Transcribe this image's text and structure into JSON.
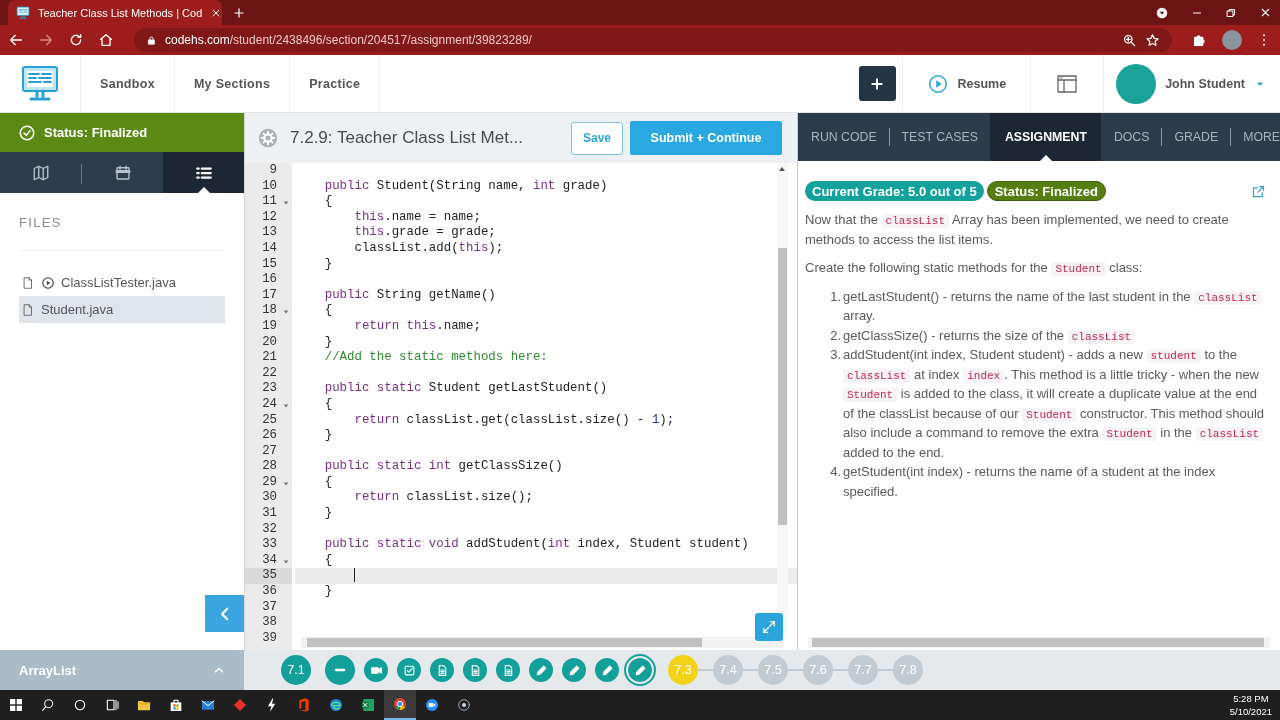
{
  "browser": {
    "tab_title": "Teacher Class List Methods | Cod",
    "url_host": "codehs.com",
    "url_path": "/student/2438496/section/204517/assignment/39823289/"
  },
  "header": {
    "nav": [
      "Sandbox",
      "My Sections",
      "Practice"
    ],
    "resume": "Resume",
    "user": "John Student"
  },
  "sidebar": {
    "status": "Status: Finalized",
    "tabs": [
      {
        "kind": "map",
        "selected": false
      },
      {
        "kind": "calendar",
        "selected": false
      },
      {
        "kind": "files",
        "selected": true
      }
    ],
    "files_heading": "FILES",
    "files": [
      {
        "name": "ClassListTester.java",
        "runnable": true,
        "selected": false
      },
      {
        "name": "Student.java",
        "runnable": false,
        "selected": true
      }
    ],
    "module": "ArrayList"
  },
  "editor": {
    "title": "7.2.9: Teacher Class List Met...",
    "save": "Save",
    "submit": "Submit + Continue",
    "lines": [
      {
        "n": "9",
        "fold": false,
        "current": false
      },
      {
        "n": "10",
        "fold": false,
        "current": false,
        "tokens": [
          {
            "t": "    public",
            "kind": "keyword"
          },
          {
            "t": " Student(String name, ",
            "kind": "plain"
          },
          {
            "t": "int",
            "kind": "keyword"
          },
          {
            "t": " grade)",
            "kind": "plain"
          }
        ]
      },
      {
        "n": "11",
        "fold": true,
        "current": false,
        "tokens": [
          {
            "t": "    {",
            "kind": "plain"
          }
        ]
      },
      {
        "n": "12",
        "fold": false,
        "current": false,
        "tokens": [
          {
            "t": "        this",
            "kind": "keyword"
          },
          {
            "t": ".name = name;",
            "kind": "plain"
          }
        ]
      },
      {
        "n": "13",
        "fold": false,
        "current": false,
        "tokens": [
          {
            "t": "        this",
            "kind": "keyword"
          },
          {
            "t": ".grade = grade;",
            "kind": "plain"
          }
        ]
      },
      {
        "n": "14",
        "fold": false,
        "current": false,
        "tokens": [
          {
            "t": "        classList.add(",
            "kind": "plain"
          },
          {
            "t": "this",
            "kind": "keyword"
          },
          {
            "t": ");",
            "kind": "plain"
          }
        ]
      },
      {
        "n": "15",
        "fold": false,
        "current": false,
        "tokens": [
          {
            "t": "    }",
            "kind": "plain"
          }
        ]
      },
      {
        "n": "16",
        "fold": false,
        "current": false
      },
      {
        "n": "17",
        "fold": false,
        "current": false,
        "tokens": [
          {
            "t": "    public",
            "kind": "keyword"
          },
          {
            "t": " String getName()",
            "kind": "plain"
          }
        ]
      },
      {
        "n": "18",
        "fold": true,
        "current": false,
        "tokens": [
          {
            "t": "    {",
            "kind": "plain"
          }
        ]
      },
      {
        "n": "19",
        "fold": false,
        "current": false,
        "tokens": [
          {
            "t": "        return this",
            "kind": "keyword"
          },
          {
            "t": ".name;",
            "kind": "plain"
          }
        ]
      },
      {
        "n": "20",
        "fold": false,
        "current": false,
        "tokens": [
          {
            "t": "    }",
            "kind": "plain"
          }
        ]
      },
      {
        "n": "21",
        "fold": false,
        "current": false,
        "tokens": [
          {
            "t": "    //Add the static methods here:",
            "kind": "comment"
          }
        ]
      },
      {
        "n": "22",
        "fold": false,
        "current": false
      },
      {
        "n": "23",
        "fold": false,
        "current": false,
        "tokens": [
          {
            "t": "    public static",
            "kind": "keyword"
          },
          {
            "t": " Student getLastStudent()",
            "kind": "plain"
          }
        ]
      },
      {
        "n": "24",
        "fold": true,
        "current": false,
        "tokens": [
          {
            "t": "    {",
            "kind": "plain"
          }
        ]
      },
      {
        "n": "25",
        "fold": false,
        "current": false,
        "tokens": [
          {
            "t": "        return",
            "kind": "keyword"
          },
          {
            "t": " classList.get(classList.size() - ",
            "kind": "plain"
          },
          {
            "t": "1",
            "kind": "number"
          },
          {
            "t": ");",
            "kind": "plain"
          }
        ]
      },
      {
        "n": "26",
        "fold": false,
        "current": false,
        "tokens": [
          {
            "t": "    }",
            "kind": "plain"
          }
        ]
      },
      {
        "n": "27",
        "fold": false,
        "current": false
      },
      {
        "n": "28",
        "fold": false,
        "current": false,
        "tokens": [
          {
            "t": "    public static int",
            "kind": "keyword"
          },
          {
            "t": " getClassSize()",
            "kind": "plain"
          }
        ]
      },
      {
        "n": "29",
        "fold": true,
        "current": false,
        "tokens": [
          {
            "t": "    {",
            "kind": "plain"
          }
        ]
      },
      {
        "n": "30",
        "fold": false,
        "current": false,
        "tokens": [
          {
            "t": "        return",
            "kind": "keyword"
          },
          {
            "t": " classList.size();",
            "kind": "plain"
          }
        ]
      },
      {
        "n": "31",
        "fold": false,
        "current": false,
        "tokens": [
          {
            "t": "    }",
            "kind": "plain"
          }
        ]
      },
      {
        "n": "32",
        "fold": false,
        "current": false
      },
      {
        "n": "33",
        "fold": false,
        "current": false,
        "tokens": [
          {
            "t": "    public static void",
            "kind": "keyword"
          },
          {
            "t": " addStudent(",
            "kind": "plain"
          },
          {
            "t": "int",
            "kind": "keyword"
          },
          {
            "t": " index, Student student)",
            "kind": "plain"
          }
        ]
      },
      {
        "n": "34",
        "fold": true,
        "current": false,
        "tokens": [
          {
            "t": "    {",
            "kind": "plain"
          }
        ]
      },
      {
        "n": "35",
        "fold": false,
        "current": true
      },
      {
        "n": "36",
        "fold": false,
        "current": false,
        "tokens": [
          {
            "t": "    }",
            "kind": "plain"
          }
        ]
      },
      {
        "n": "37",
        "fold": false,
        "current": false
      },
      {
        "n": "38",
        "fold": false,
        "current": false
      },
      {
        "n": "39",
        "fold": false,
        "current": false
      }
    ]
  },
  "assignment": {
    "tabs": [
      {
        "label": "RUN CODE",
        "selected": false
      },
      {
        "label": "TEST CASES",
        "selected": false
      },
      {
        "label": "ASSIGNMENT",
        "selected": true
      },
      {
        "label": "DOCS",
        "selected": false
      },
      {
        "label": "GRADE",
        "selected": false
      },
      {
        "label": "MORE",
        "selected": false
      }
    ],
    "grade": "Current Grade: 5.0 out of 5",
    "status": "Status: Finalized",
    "paragraphs": [
      [
        {
          "t": "Now that the ",
          "kind": "text"
        },
        {
          "t": "classList",
          "kind": "code"
        },
        {
          "t": " Array has been implemented, we need to create methods to access the list items.",
          "kind": "text"
        }
      ],
      [
        {
          "t": "Create the following static methods for the ",
          "kind": "text"
        },
        {
          "t": "Student",
          "kind": "code"
        },
        {
          "t": " class:",
          "kind": "text"
        }
      ]
    ],
    "steps": [
      {
        "marker": "1.",
        "parts": [
          {
            "t": "getLastStudent() - returns the name of the last student in the ",
            "kind": "text"
          },
          {
            "t": "classList",
            "kind": "code"
          },
          {
            "t": " array.",
            "kind": "text"
          }
        ]
      },
      {
        "marker": "2.",
        "parts": [
          {
            "t": "getClassSize() - returns the size of the ",
            "kind": "text"
          },
          {
            "t": "classList",
            "kind": "code"
          }
        ]
      },
      {
        "marker": "3.",
        "parts": [
          {
            "t": "addStudent(int index, Student student) - adds a new ",
            "kind": "text"
          },
          {
            "t": "student",
            "kind": "code"
          },
          {
            "t": " to the ",
            "kind": "text"
          },
          {
            "t": "classList",
            "kind": "code"
          },
          {
            "t": " at index ",
            "kind": "text"
          },
          {
            "t": "index",
            "kind": "code"
          },
          {
            "t": ". This method is a little tricky - when the new ",
            "kind": "text"
          },
          {
            "t": "Student",
            "kind": "code"
          },
          {
            "t": " is added to the class, it will create a duplicate value at the end of the classList because of our ",
            "kind": "text"
          },
          {
            "t": "Student",
            "kind": "code"
          },
          {
            "t": " constructor. This method should also include a command to remove the extra ",
            "kind": "text"
          },
          {
            "t": "Student",
            "kind": "code"
          },
          {
            "t": " in the ",
            "kind": "text"
          },
          {
            "t": "classList",
            "kind": "code"
          },
          {
            "t": " added to the end.",
            "kind": "text"
          }
        ]
      },
      {
        "marker": "4.",
        "parts": [
          {
            "t": "getStudent(int index) - returns the name of a student at the index specified.",
            "kind": "text"
          }
        ]
      }
    ]
  },
  "progress": {
    "items": [
      {
        "kind": "lesson",
        "label": "7.1",
        "completed": true,
        "current": false,
        "selected": false
      },
      {
        "kind": "collapse",
        "selected": false
      },
      {
        "kind": "video",
        "selected": false
      },
      {
        "kind": "quiz",
        "selected": false
      },
      {
        "kind": "document",
        "selected": false
      },
      {
        "kind": "document",
        "selected": false
      },
      {
        "kind": "document",
        "selected": false
      },
      {
        "kind": "exercise",
        "selected": false
      },
      {
        "kind": "exercise",
        "selected": false
      },
      {
        "kind": "exercise",
        "selected": false
      },
      {
        "kind": "exercise",
        "selected": true
      },
      {
        "kind": "lesson",
        "label": "7.3",
        "completed": false,
        "current": true,
        "selected": false
      },
      {
        "kind": "lesson",
        "label": "7.4",
        "completed": false,
        "current": false,
        "selected": false
      },
      {
        "kind": "lesson",
        "label": "7.5",
        "completed": false,
        "current": false,
        "selected": false
      },
      {
        "kind": "lesson",
        "label": "7.6",
        "completed": false,
        "current": false,
        "selected": false
      },
      {
        "kind": "lesson",
        "label": "7.7",
        "completed": false,
        "current": false,
        "selected": false
      },
      {
        "kind": "lesson",
        "label": "7.8",
        "completed": false,
        "current": false,
        "selected": false
      }
    ]
  },
  "taskbar": {
    "apps": [
      {
        "kind": "start",
        "active": false
      },
      {
        "kind": "search",
        "active": false
      },
      {
        "kind": "assistant",
        "active": false
      },
      {
        "kind": "taskview",
        "active": false
      },
      {
        "kind": "folder",
        "active": false
      },
      {
        "kind": "store",
        "active": false
      },
      {
        "kind": "mail",
        "active": false
      },
      {
        "kind": "diamond",
        "active": false
      },
      {
        "kind": "bolt",
        "active": false
      },
      {
        "kind": "office",
        "active": false
      },
      {
        "kind": "edge",
        "active": false
      },
      {
        "kind": "sheet",
        "active": false
      },
      {
        "kind": "browser",
        "active": true
      },
      {
        "kind": "camera",
        "active": false
      },
      {
        "kind": "record",
        "active": false
      }
    ],
    "time": "5:28 PM",
    "date": "5/10/2021"
  }
}
